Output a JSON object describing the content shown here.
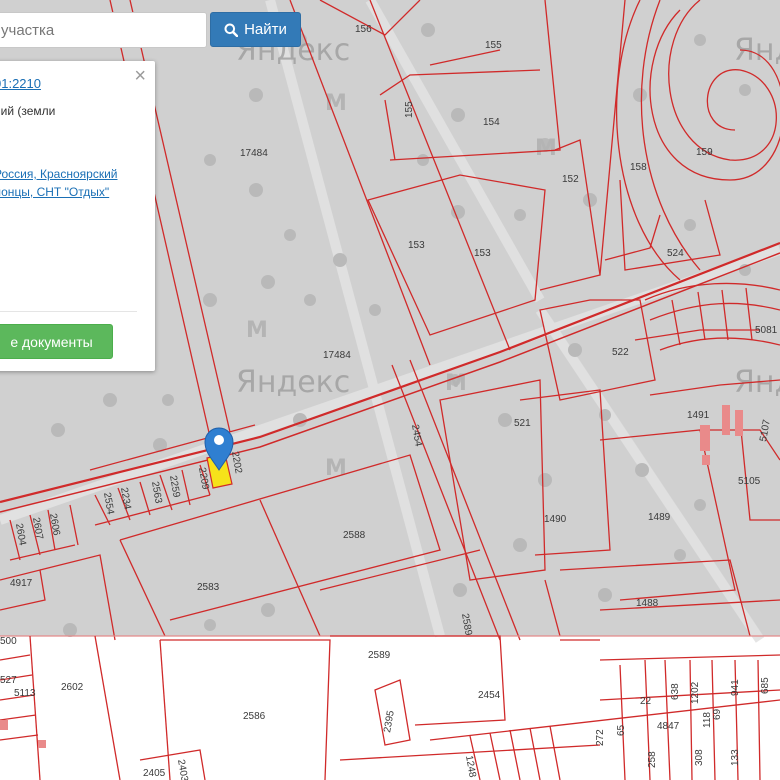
{
  "search": {
    "placeholder": "участка",
    "button_label": "Найти",
    "button_icon": "search-icon"
  },
  "info_panel": {
    "close_label": "×",
    "parcel_number": "01:2210",
    "category": "ний (земли",
    "address_line1": "Россия, Красноярский",
    "address_line2": "лонцы, СНТ \"Отдых\"",
    "documents_button": "е документы"
  },
  "map": {
    "watermark": "Яндекс",
    "colors": {
      "boundary": "#d02a2a",
      "highlight_parcel": "#f6e21a",
      "marker": "#2f7fd1",
      "basemap": "#d0d0d0"
    },
    "parcel_labels": [
      "156",
      "155",
      "154",
      "155",
      "17484",
      "152",
      "153",
      "153",
      "158",
      "159",
      "524",
      "5081",
      "522",
      "17484",
      "2454",
      "521",
      "1491",
      "5107",
      "5105",
      "2202",
      "2209",
      "2259",
      "2563",
      "2234",
      "2554",
      "2606",
      "2607",
      "2604",
      "2588",
      "1490",
      "1489",
      "4917",
      "2583",
      "1488",
      "2589",
      "2589",
      "2602",
      "5113",
      "527",
      "500",
      "2454",
      "2586",
      "2395",
      "2405",
      "2403",
      "1248",
      "272",
      "22",
      "638",
      "1202",
      "941",
      "685",
      "65",
      "69",
      "4847",
      "118",
      "308",
      "133",
      "258"
    ]
  }
}
